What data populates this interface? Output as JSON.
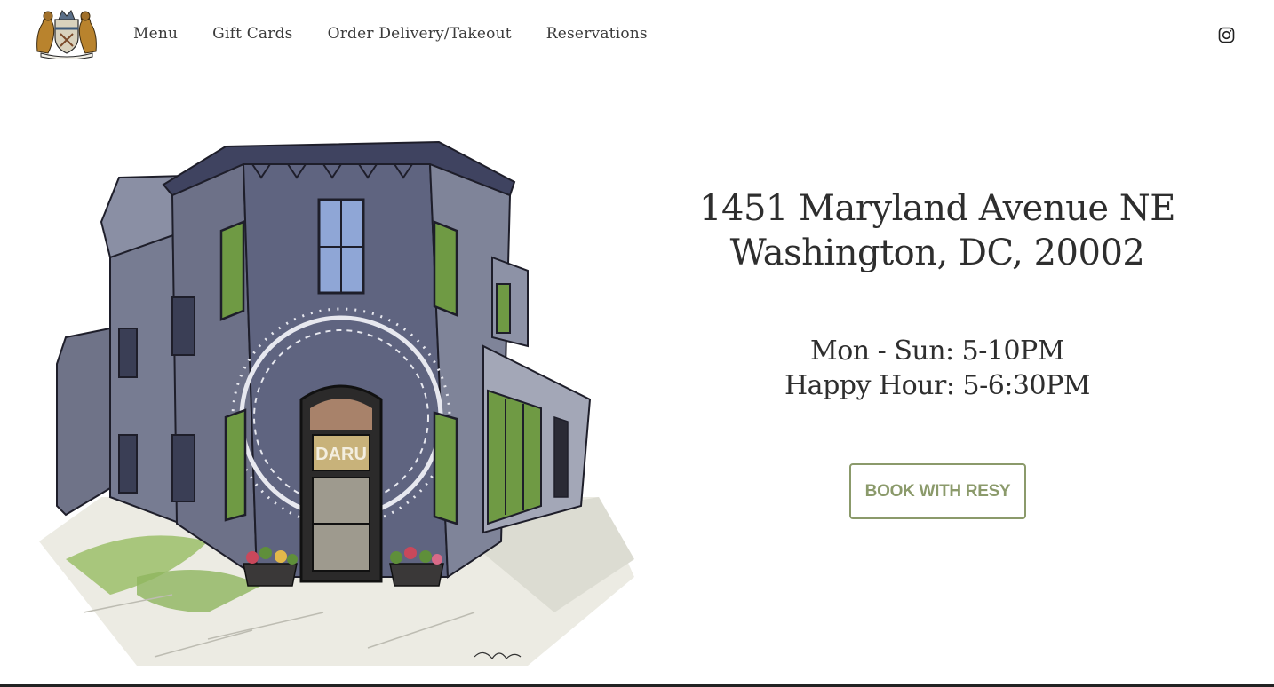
{
  "header": {
    "logo_icon": "crest-logo-icon",
    "nav": [
      {
        "label": "Menu"
      },
      {
        "label": "Gift Cards"
      },
      {
        "label": "Order Delivery/Takeout"
      },
      {
        "label": "Reservations"
      }
    ],
    "social_icon": "instagram-icon"
  },
  "hero": {
    "illustration_icon": "restaurant-building-illustration",
    "storefront_sign": "DARU",
    "address_line1": "1451 Maryland Avenue NE",
    "address_line2": "Washington, DC, 20002",
    "hours_line1": "Mon - Sun: 5-10PM",
    "hours_line2": "Happy Hour: 5-6:30PM",
    "book_button": "BOOK WITH RESY"
  },
  "colors": {
    "accent": "#8b9a6b",
    "text": "#2e2e2e"
  }
}
